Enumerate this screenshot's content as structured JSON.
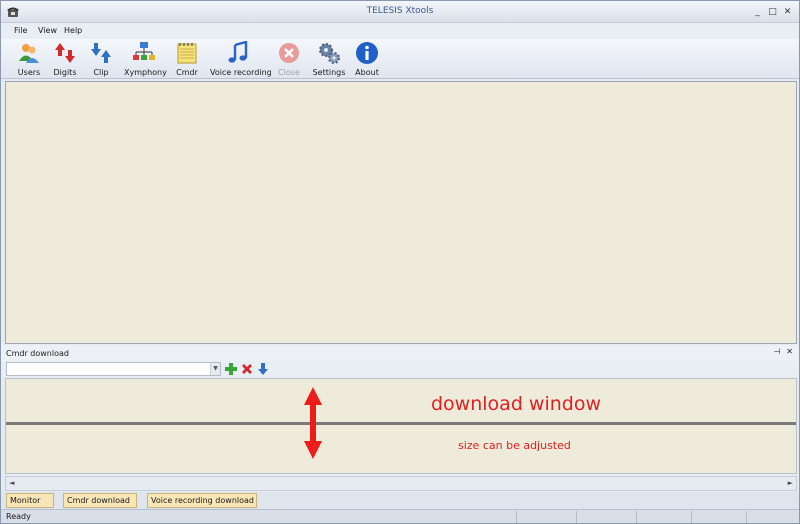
{
  "window": {
    "title": "TELESIS Xtools",
    "controls": [
      "_",
      "□",
      "✕"
    ]
  },
  "menu": {
    "items": [
      "File",
      "View",
      "Help"
    ]
  },
  "toolbar": {
    "items": [
      {
        "label": "Users",
        "icon": "users-icon"
      },
      {
        "label": "Digits",
        "icon": "digits-arrows-icon"
      },
      {
        "label": "Clip",
        "icon": "clip-arrows-icon"
      },
      {
        "label": "Xymphony",
        "icon": "network-icon"
      },
      {
        "label": "Cmdr",
        "icon": "notepad-icon"
      },
      {
        "label": "Voice recording",
        "icon": "music-note-icon"
      },
      {
        "label": "Close",
        "icon": "close-circle-icon",
        "disabled": true
      },
      {
        "label": "Settings",
        "icon": "gears-icon"
      },
      {
        "label": "About",
        "icon": "info-icon"
      }
    ]
  },
  "download_panel": {
    "title": "Cmdr download",
    "pin": "⊣",
    "close": "✕",
    "select_value": "",
    "annotation_main": "download window",
    "annotation_sub": "size can be adjusted"
  },
  "hscroll": {
    "left": "◄",
    "right": "►"
  },
  "tabs": [
    "Monitor",
    "Cmdr download",
    "Voice recording download"
  ],
  "status": {
    "text": "Ready"
  },
  "colors": {
    "annotation": "#e21f1f",
    "workspace": "#efebdb",
    "tab": "#f7e6b6"
  }
}
